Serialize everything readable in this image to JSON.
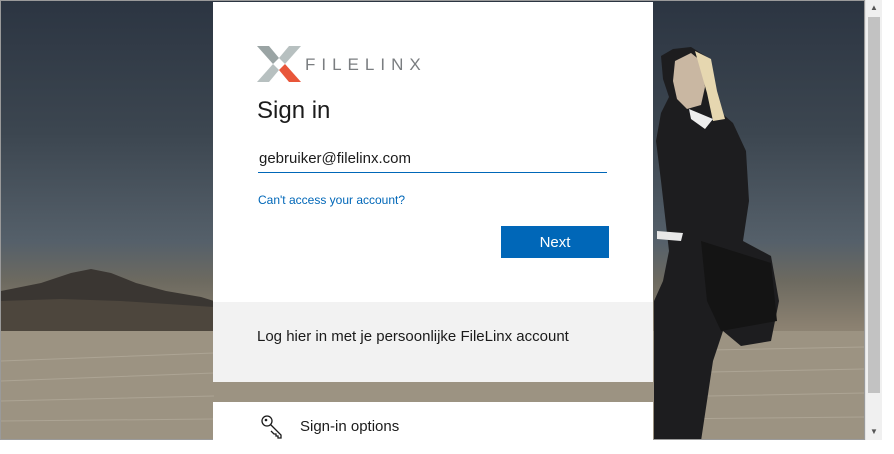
{
  "brand": {
    "name": "FILELINX"
  },
  "signin": {
    "title": "Sign in",
    "email_value": "gebruiker@filelinx.com",
    "cant_access_link": "Can't access your account?",
    "next_button": "Next"
  },
  "info": {
    "text": "Log hier in met je persoonlijke FileLinx account"
  },
  "options": {
    "label": "Sign-in options"
  },
  "scrollbar": {
    "up_arrow": "▲",
    "down_arrow": "▼"
  },
  "colors": {
    "accent": "#0067b8",
    "logo_gray": "#9aa4a4",
    "logo_orange": "#e8563a"
  }
}
